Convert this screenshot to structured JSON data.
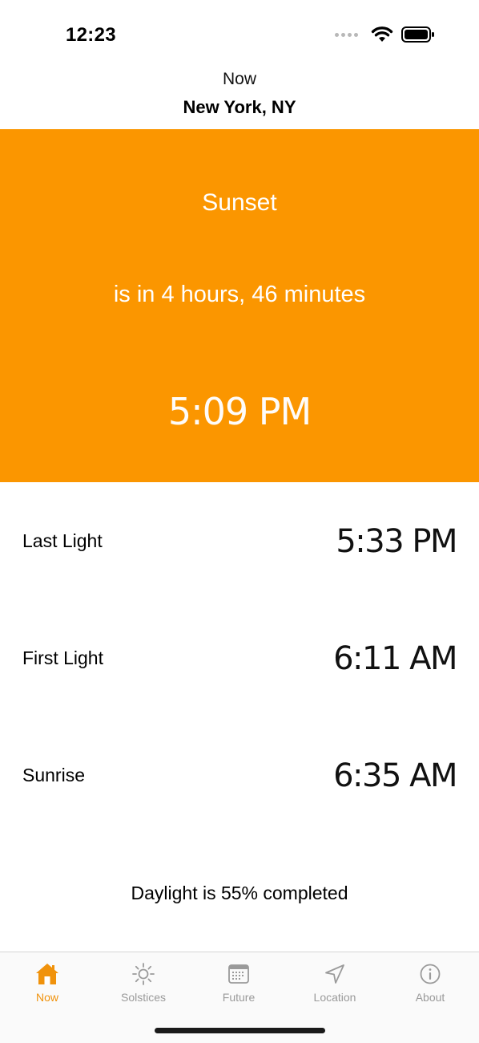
{
  "status_bar": {
    "time": "12:23"
  },
  "header": {
    "title": "Now",
    "location": "New York, NY"
  },
  "hero": {
    "event": "Sunset",
    "countdown": "is in 4 hours, 46 minutes",
    "time": "5:09 PM",
    "background_color": "#fb9600"
  },
  "rows": [
    {
      "label": "Last Light",
      "time": "5:33 PM"
    },
    {
      "label": "First Light",
      "time": "6:11 AM"
    },
    {
      "label": "Sunrise",
      "time": "6:35 AM"
    }
  ],
  "daylight_text": "Daylight is 55% completed",
  "tabs": [
    {
      "label": "Now",
      "icon": "house-icon",
      "active": true
    },
    {
      "label": "Solstices",
      "icon": "sun-icon",
      "active": false
    },
    {
      "label": "Future",
      "icon": "calendar-icon",
      "active": false
    },
    {
      "label": "Location",
      "icon": "location-arrow-icon",
      "active": false
    },
    {
      "label": "About",
      "icon": "info-icon",
      "active": false
    }
  ],
  "colors": {
    "accent": "#f0920b",
    "inactive_tab": "#9a9a9a"
  }
}
